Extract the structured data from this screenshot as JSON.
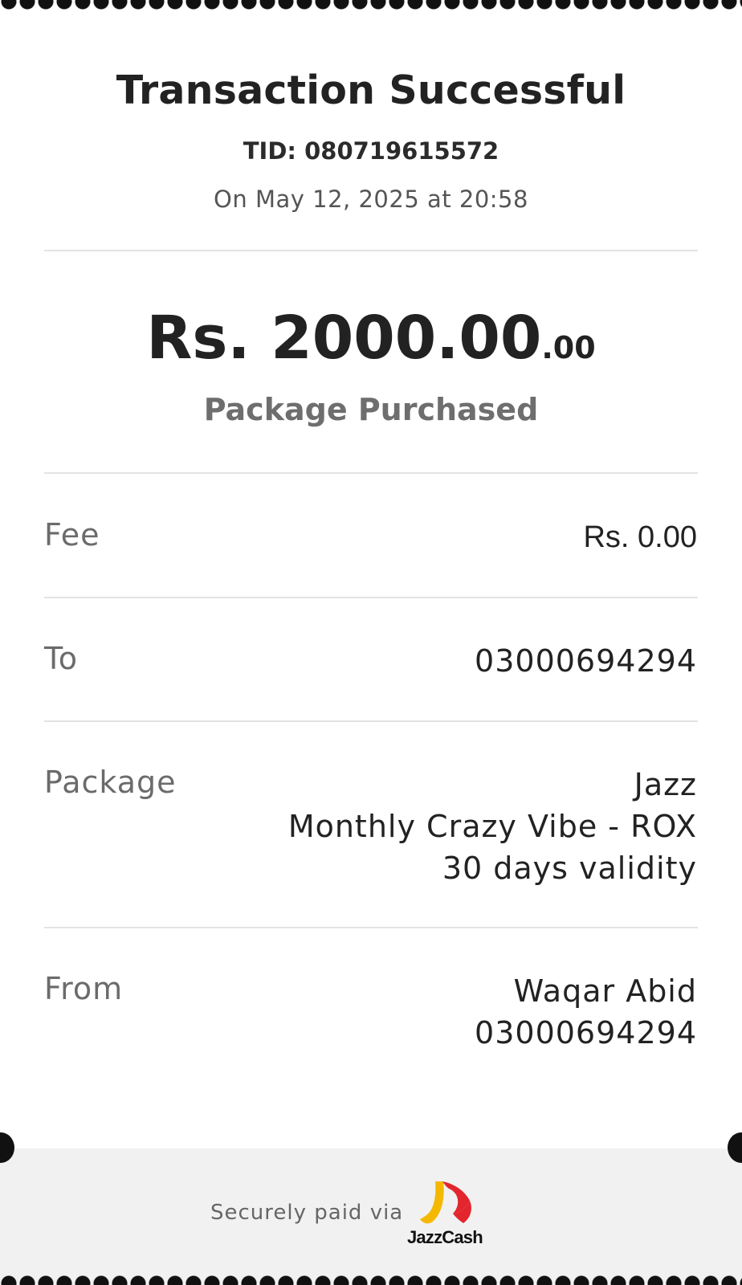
{
  "receipt": {
    "title": "Transaction Successful",
    "tid": "TID: 080719615572",
    "datetime": "On May 12, 2025 at 20:58",
    "amount_main": "Rs. 2000.00",
    "amount_decimal": ".00",
    "purpose": "Package Purchased"
  },
  "details": {
    "fee": {
      "label": "Fee",
      "value": "Rs. 0.00"
    },
    "to": {
      "label": "To",
      "value": "03000694294"
    },
    "package": {
      "label": "Package",
      "lines": [
        "Jazz",
        "Monthly Crazy Vibe - ROX",
        "30 days validity"
      ]
    },
    "from": {
      "label": "From",
      "lines": [
        "Waqar Abid",
        "03000694294"
      ]
    }
  },
  "footer": {
    "secure_text": "Securely paid via",
    "brand": "JazzCash",
    "brand_colors": {
      "yellow": "#f5b800",
      "red": "#e3262d"
    }
  }
}
